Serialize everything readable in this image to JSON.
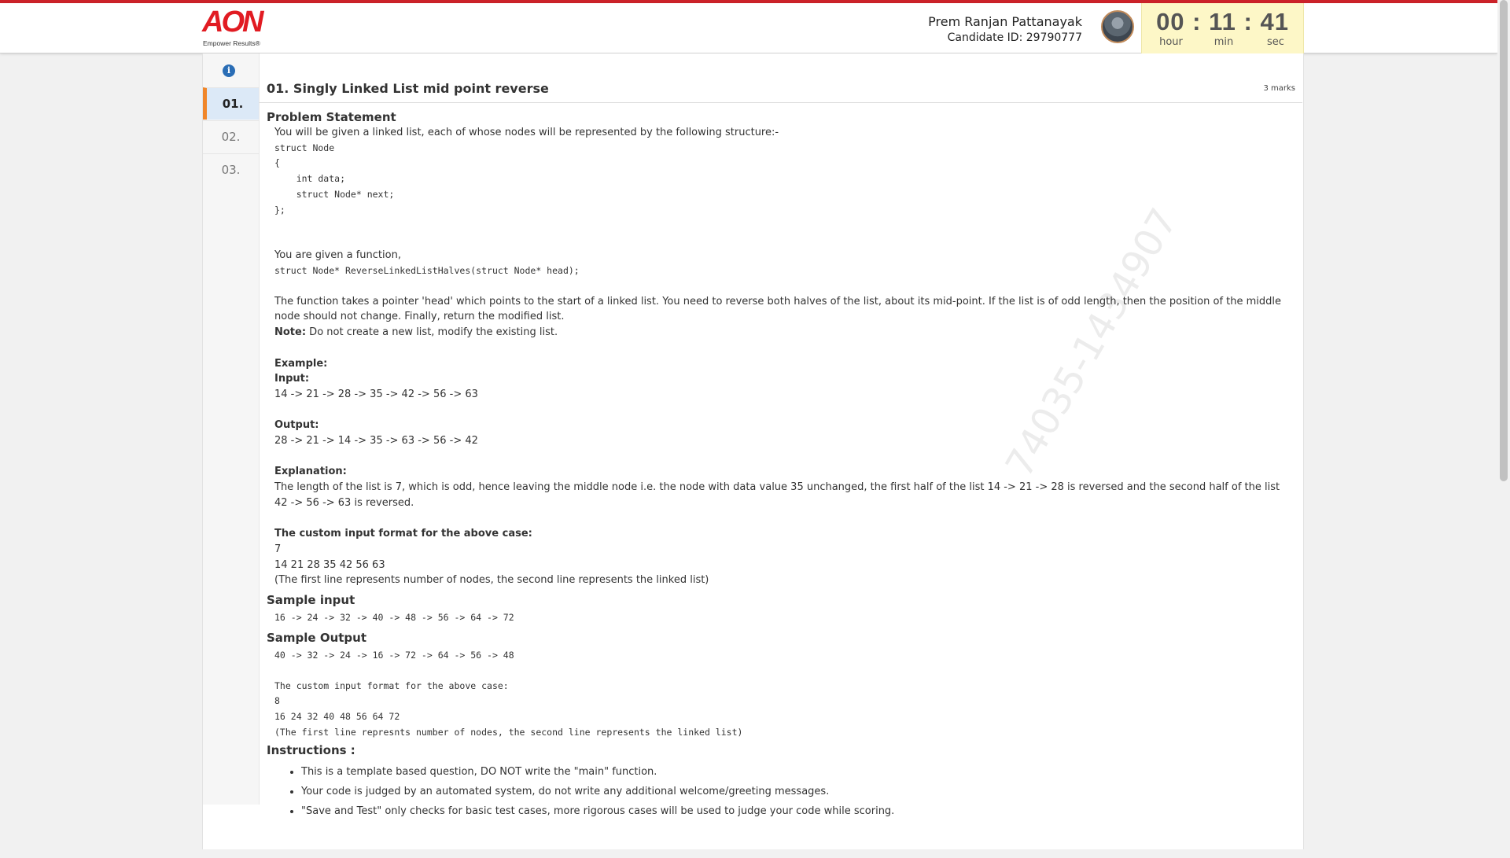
{
  "brand": {
    "logo_text": "AON",
    "tagline": "Empower Results®"
  },
  "candidate": {
    "name": "Prem Ranjan Pattanayak",
    "id_label": "Candidate ID: 29790777"
  },
  "timer": {
    "hours": "00",
    "minutes": "11",
    "seconds": "41",
    "hour_label": "hour",
    "min_label": "min",
    "sec_label": "sec"
  },
  "nav": {
    "info_icon": "info-icon",
    "questions": [
      "01.",
      "02.",
      "03."
    ]
  },
  "question": {
    "title": "01.  Singly Linked List mid point reverse",
    "marks": "3 marks",
    "problem_heading": "Problem Statement",
    "intro": "You will be given a linked list, each of whose nodes will be represented by the following structure:-",
    "struct_code": "struct Node\n{\n    int data;\n    struct Node* next;\n};",
    "func_intro": "You are given a function,",
    "func_sig": "struct Node* ReverseLinkedListHalves(struct Node* head);",
    "description": "The function takes a pointer 'head' which points to the start of a linked list. You need to reverse both halves of the list, about its mid-point. If the list is of odd length, then the position of the middle node should not change. Finally, return the modified list.",
    "note_label": "Note:",
    "note_text": " Do not create a new list, modify the existing list.",
    "example_label": "Example:",
    "input_label": "Input:",
    "input_value": "14 -> 21 -> 28 -> 35 -> 42 -> 56 -> 63",
    "output_label": "Output:",
    "output_value": "28 -> 21 -> 14 -> 35 -> 63 -> 56 -> 42",
    "explanation_label": "Explanation:",
    "explanation_text": "The length of the list is 7, which is odd, hence leaving the middle node i.e. the node with data value 35 unchanged, the first half of the list 14 -> 21 -> 28 is reversed and the second half of the list 42 -> 56 -> 63 is reversed.",
    "custom_label": "The custom input format for the above case:",
    "custom_n": "7",
    "custom_list": "14 21 28 35 42 56 63",
    "custom_note": "(The first line represents number of nodes, the second line represents the linked list)",
    "sample_input_heading": "Sample input",
    "sample_input": "16 -> 24 -> 32 -> 40 -> 48 -> 56 -> 64 -> 72",
    "sample_output_heading": "Sample Output",
    "sample_output": "40 -> 32 -> 24 -> 16 -> 72 -> 64 -> 56 -> 48",
    "sample_custom_label": "The custom input format for the above case:",
    "sample_custom_n": "8",
    "sample_custom_list": "16 24 32 40 48 56 64 72",
    "sample_custom_note": "(The first line represnts number of nodes, the second line represents the linked list)",
    "instructions_heading": "Instructions :",
    "instructions": [
      "This is a template based question, DO NOT write the \"main\" function.",
      "Your code is judged by an automated system, do not write any additional welcome/greeting messages.",
      "\"Save and Test\" only checks for basic test cases, more rigorous cases will be used to judge your code while scoring."
    ]
  },
  "watermark": "74035-1434907"
}
